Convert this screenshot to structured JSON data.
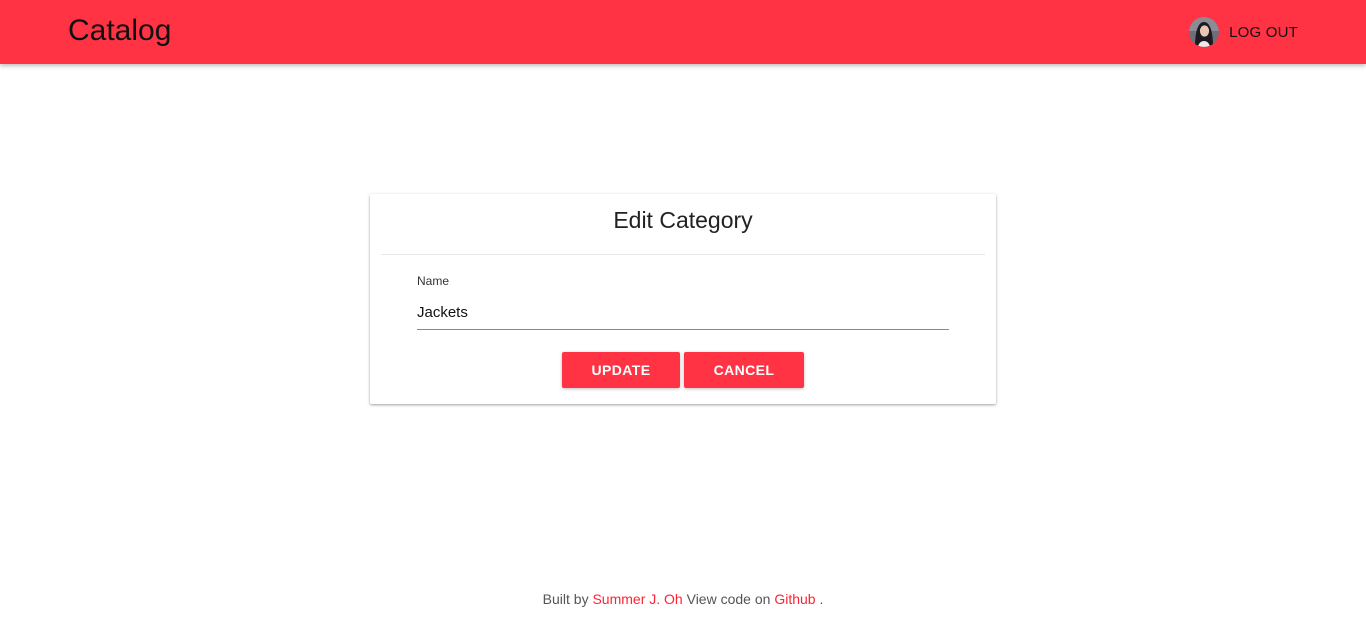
{
  "header": {
    "brand": "Catalog",
    "logout_label": "LOG OUT",
    "avatar_icon": "user-avatar-photo",
    "background_color": "#ff3344"
  },
  "edit_card": {
    "title": "Edit Category",
    "name_label": "Name",
    "name_value": "Jackets",
    "update_label": "UPDATE",
    "cancel_label": "CANCEL",
    "button_color": "#ff3344"
  },
  "footer": {
    "prefix": "Built by",
    "author_link": "Summer J. Oh",
    "middle": "View code on",
    "github_link": "Github",
    "suffix": ".",
    "link_color": "#ff2233"
  }
}
